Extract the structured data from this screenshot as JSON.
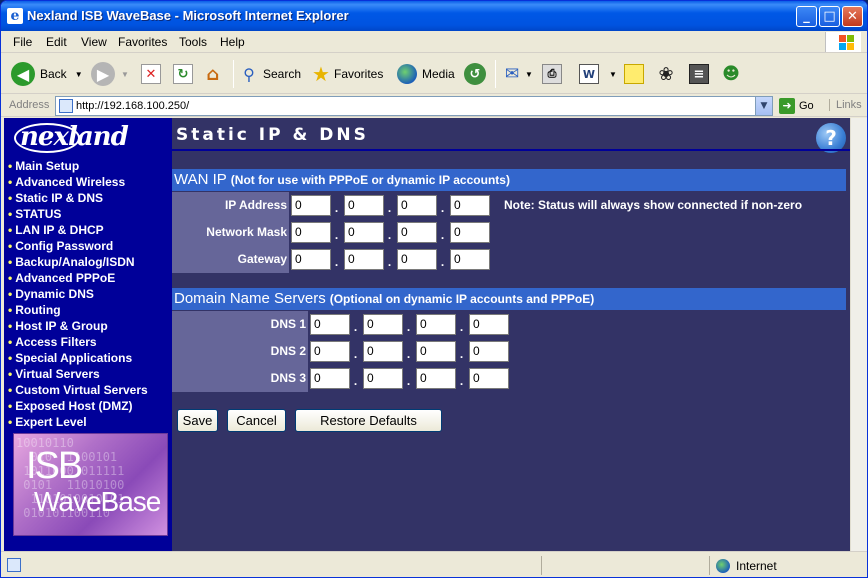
{
  "window": {
    "title": "Nexland ISB WaveBase - Microsoft Internet Explorer",
    "controls": {
      "minimize": "_",
      "maximize": "□",
      "close": "✕"
    }
  },
  "menu": [
    "File",
    "Edit",
    "View",
    "Favorites",
    "Tools",
    "Help"
  ],
  "toolbar": {
    "back_label": "Back",
    "search_label": "Search",
    "favorites_label": "Favorites",
    "media_label": "Media",
    "icons": [
      "back-icon",
      "forward-icon",
      "stop-icon",
      "refresh-icon",
      "home-icon",
      "search-icon",
      "favorites-icon",
      "media-icon",
      "history-icon",
      "mail-icon",
      "print-icon",
      "edit-icon",
      "discuss-icon",
      "flower-icon",
      "research-icon",
      "messenger-icon"
    ]
  },
  "address": {
    "label": "Address",
    "url": "http://192.168.100.250/",
    "go_label": "Go",
    "links_label": "Links"
  },
  "sidebar": {
    "logo_text": "nexland",
    "items": [
      "Main Setup",
      "Advanced Wireless",
      "Static IP & DNS",
      "STATUS",
      "LAN IP & DHCP",
      "Config Password",
      "Backup/Analog/ISDN",
      "Advanced PPPoE",
      "Dynamic DNS",
      "Routing",
      "Host IP & Group",
      "Access Filters",
      "Special Applications",
      "Virtual Servers",
      "Custom Virtual Servers",
      "Exposed Host (DMZ)",
      "Expert Level"
    ],
    "active_index": 2,
    "brand": {
      "line1": "ISB",
      "line2": "WaveBase"
    }
  },
  "main": {
    "title": "Static IP & DNS",
    "help_label": "?",
    "wan": {
      "heading": "WAN IP",
      "subheading": "(Not for use with PPPoE or dynamic IP accounts)",
      "note": "Note: Status will always show connected if non-zero",
      "rows": [
        {
          "label": "IP Address",
          "octets": [
            "0",
            "0",
            "0",
            "0"
          ]
        },
        {
          "label": "Network Mask",
          "octets": [
            "0",
            "0",
            "0",
            "0"
          ]
        },
        {
          "label": "Gateway",
          "octets": [
            "0",
            "0",
            "0",
            "0"
          ]
        }
      ]
    },
    "dns": {
      "heading": "Domain Name Servers",
      "subheading": "(Optional on dynamic IP accounts and PPPoE)",
      "rows": [
        {
          "label": "DNS 1",
          "octets": [
            "0",
            "0",
            "0",
            "0"
          ]
        },
        {
          "label": "DNS 2",
          "octets": [
            "0",
            "0",
            "0",
            "0"
          ]
        },
        {
          "label": "DNS 3",
          "octets": [
            "0",
            "0",
            "0",
            "0"
          ]
        }
      ]
    },
    "buttons": {
      "save": "Save",
      "cancel": "Cancel",
      "restore": "Restore Defaults"
    }
  },
  "status": {
    "zone": "Internet"
  },
  "colors": {
    "page_bg": "#333366",
    "nav_bg": "#000099",
    "section_header": "#3366cc",
    "field_label_bg": "#666699",
    "nav_bullet": "#ffff66"
  }
}
